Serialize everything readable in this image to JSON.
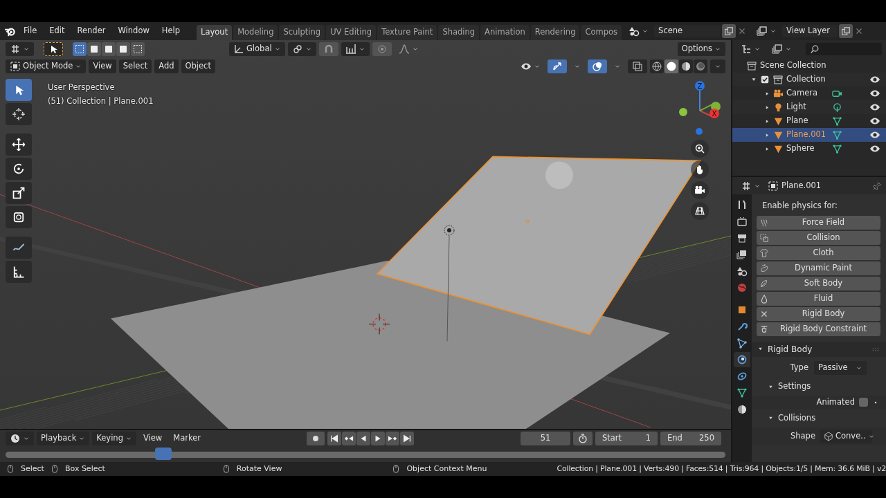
{
  "menu_bar": {
    "menus": [
      "File",
      "Edit",
      "Render",
      "Window",
      "Help"
    ]
  },
  "workspace_tabs": [
    {
      "label": "Layout",
      "selected": true
    },
    {
      "label": "Modeling",
      "selected": false
    },
    {
      "label": "Sculpting",
      "selected": false
    },
    {
      "label": "UV Editing",
      "selected": false
    },
    {
      "label": "Texture Paint",
      "selected": false
    },
    {
      "label": "Shading",
      "selected": false
    },
    {
      "label": "Animation",
      "selected": false
    },
    {
      "label": "Rendering",
      "selected": false
    },
    {
      "label": "Compos",
      "selected": false
    }
  ],
  "scene": {
    "value": "Scene"
  },
  "view_layer": {
    "value": "View Layer"
  },
  "viewport": {
    "tool_header": {
      "orientation": "Global",
      "options": "Options",
      "snap": {
        "on": false
      }
    },
    "header": {
      "mode": "Object Mode",
      "menus": [
        "View",
        "Select",
        "Add",
        "Object"
      ],
      "gizmos": {
        "on": true
      },
      "overlays": {
        "on": true
      },
      "shading_modes": [
        {
          "kind": "wireframe",
          "selected": false
        },
        {
          "kind": "solid",
          "selected": true
        },
        {
          "kind": "material",
          "selected": false
        },
        {
          "kind": "rendered",
          "selected": false
        }
      ]
    },
    "tools": [
      {
        "kind": "select",
        "selected": true
      },
      {
        "kind": "cursor",
        "selected": false
      },
      {
        "kind": "move",
        "selected": false
      },
      {
        "kind": "rotate",
        "selected": false
      },
      {
        "kind": "scale",
        "selected": false
      },
      {
        "kind": "transform",
        "selected": false
      },
      {
        "kind": "annotate",
        "selected": false
      },
      {
        "kind": "measure",
        "selected": false
      }
    ],
    "overlay_text": [
      "User Perspective",
      "(51) Collection | Plane.001"
    ],
    "gizmo_labels": [
      "Z",
      "X"
    ]
  },
  "outliner": {
    "root": "Scene Collection",
    "items": [
      {
        "label": "Collection",
        "checked": true,
        "expanded": true,
        "children": [
          {
            "label": "Camera",
            "kind": "camera",
            "selected": false
          },
          {
            "label": "Light",
            "kind": "light",
            "selected": false
          },
          {
            "label": "Plane",
            "kind": "mesh",
            "selected": false
          },
          {
            "label": "Plane.001",
            "kind": "mesh",
            "selected": true
          },
          {
            "label": "Sphere",
            "kind": "mesh",
            "selected": false
          }
        ]
      }
    ]
  },
  "properties": {
    "object_name": "Plane.001",
    "tabs": [
      {
        "kind": "tool",
        "selected": false
      },
      {
        "kind": "render",
        "selected": false
      },
      {
        "kind": "output",
        "selected": false
      },
      {
        "kind": "view_layer",
        "selected": false
      },
      {
        "kind": "scene",
        "selected": false
      },
      {
        "kind": "world",
        "selected": false
      },
      {
        "kind": "object",
        "selected": false
      },
      {
        "kind": "modifiers",
        "selected": false
      },
      {
        "kind": "particles",
        "selected": false
      },
      {
        "kind": "physics",
        "selected": true
      },
      {
        "kind": "constraints",
        "selected": false
      },
      {
        "kind": "data",
        "selected": false
      },
      {
        "kind": "material",
        "selected": false
      }
    ],
    "heading": "Enable physics for:",
    "physics_buttons": [
      {
        "label": "Force Field",
        "enabled": false
      },
      {
        "label": "Collision",
        "enabled": false
      },
      {
        "label": "Cloth",
        "enabled": false
      },
      {
        "label": "Dynamic Paint",
        "enabled": false
      },
      {
        "label": "Soft Body",
        "enabled": false
      },
      {
        "label": "Fluid",
        "enabled": false
      },
      {
        "label": "Rigid Body",
        "enabled": true
      },
      {
        "label": "Rigid Body Constraint",
        "enabled": false
      }
    ],
    "panel": {
      "title": "Rigid Body",
      "expanded": true,
      "type_label": "Type",
      "type_value": "Passive",
      "subpanels": [
        {
          "title": "Settings",
          "expanded": true,
          "row": {
            "kind": "checkbox",
            "label": "Animated",
            "checked": false
          }
        },
        {
          "title": "Collisions",
          "expanded": true,
          "row": {
            "kind": "dropdown",
            "label": "Shape",
            "value": "Conve.."
          }
        }
      ]
    }
  },
  "timeline": {
    "menus": [
      "Playback",
      "Keying",
      "View",
      "Marker"
    ],
    "current_frame": "51",
    "start_label": "Start",
    "start": "1",
    "end_label": "End",
    "end": "250"
  },
  "status_bar": {
    "hints": [
      {
        "kind": "left",
        "label": "Select"
      },
      {
        "kind": "drag",
        "label": "Box Select"
      },
      {
        "kind": "middle",
        "label": "Rotate View"
      },
      {
        "kind": "right",
        "label": "Object Context Menu"
      }
    ],
    "stats": "Collection | Plane.001 | Verts:490 | Faces:514 | Tris:964 | Objects:1/5 | Mem: 36.6 MiB | v2"
  }
}
